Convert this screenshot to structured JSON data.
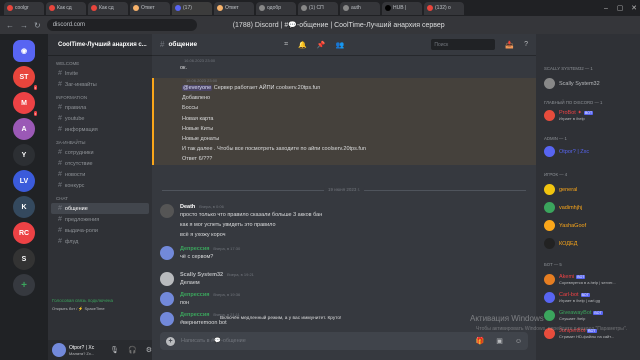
{
  "browser": {
    "tabs": [
      {
        "label": "coolgr",
        "color": "#e8453c"
      },
      {
        "label": "Как сд",
        "color": "#e8453c"
      },
      {
        "label": "Как сд",
        "color": "#e8453c"
      },
      {
        "label": "Ответ",
        "color": "#f6b26b"
      },
      {
        "label": "(17)",
        "color": "#5865f2"
      },
      {
        "label": "Ответ",
        "color": "#f6b26b"
      },
      {
        "label": "одобр",
        "color": "#888"
      },
      {
        "label": "(1) СП",
        "color": "#888"
      },
      {
        "label": "auth",
        "color": "#888"
      },
      {
        "label": "HUB |",
        "color": "#000"
      },
      {
        "label": "(132) о",
        "color": "#e8453c"
      }
    ],
    "url": "discord.com",
    "page_title": "(1788) Discord | #💬-общение | CoolTime-Лучший анархия сервер"
  },
  "left_bar": [
    "ST",
    "M",
    "A",
    "Y",
    "LV",
    "K",
    "RC",
    "S"
  ],
  "server_name": "CoolTime-Лучший анархия с...",
  "channels": {
    "top": [
      {
        "label": "Invite",
        "active": false
      },
      {
        "label": "Заг-инвайты",
        "active": false
      }
    ],
    "category1": "information",
    "info": [
      "правила",
      "youtube",
      "информация"
    ],
    "category2": "за-инвайты",
    "group": [
      "сотрудники",
      "отсутствие",
      "новости",
      "конкурс"
    ],
    "category3": "Chat",
    "chat": [
      {
        "label": "общение",
        "active": true
      },
      {
        "label": "предложения",
        "active": false
      },
      {
        "label": "выдача-роли",
        "active": false
      },
      {
        "label": "флуд",
        "active": false
      }
    ],
    "welcome_cat": "WELCOME"
  },
  "voice": {
    "status": "Голосовая связь подключена",
    "sub": "Открыть бот / ⚡ SpaceTime"
  },
  "user": {
    "name": "Otpor? | Xc",
    "tag": "Малата? Zx..."
  },
  "header": {
    "channel": "общение",
    "search_placeholder": "Поиск"
  },
  "messages": [
    {
      "author": "",
      "time": "16.06.2023 23:00",
      "author_color": "#e67e22",
      "lines": [
        "ок."
      ]
    },
    {
      "author": "",
      "time": "16.06.2023 23:00",
      "author_color": "#e67e22",
      "lines": [
        "@everyone Сервер работает АЙПИ coolserv.20tps.fun",
        "Добавлено",
        "Боссы",
        "Новая карта",
        "Новые Киты",
        "Новые донаты",
        "И так далее . Чтобы все посмотреть заходите по айпи coolserv.20tps.fun",
        "Ответ 6/???"
      ]
    },
    {
      "author": "Death",
      "time": "Вчера, в 0:06",
      "author_color": "#ffffff",
      "lines": [
        "просто только что правило сказали больше 3 акков бан",
        "как я мог успеть увидеть это правило",
        "всё я ухожу короч"
      ]
    },
    {
      "author": "Депрессия",
      "time": "Вчера, в 17:30",
      "author_color": "#3ba55d",
      "lines": [
        "чё с сервом?"
      ]
    },
    {
      "author": "Scally System32",
      "time": "Вчера, в 19:21",
      "author_color": "#b9bbbe",
      "lines": [
        "Делаем"
      ]
    },
    {
      "author": "Депрессия",
      "time": "Вчера, в 19:36",
      "author_color": "#3ba55d",
      "lines": [
        "пон"
      ]
    },
    {
      "author": "Депрессия",
      "time": "Вчера, в 21:11",
      "author_color": "#3ba55d",
      "lines": [
        "#вернитеmoon bot"
      ]
    }
  ],
  "date_divider": "19 июня 2023 г.",
  "composer_placeholder": "Написать в #💬-общение",
  "typing": "Включён медленный режим, а у вас иммунитет. Круто!",
  "members": {
    "cats": [
      {
        "label": "SCALLY SYSTEM32 — 1"
      },
      {
        "label": "ГЛАВНЫЙ ПО DISCORD — 1"
      },
      {
        "label": "ADMIN — 1"
      },
      {
        "label": "ИГРОК — 4"
      },
      {
        "label": "БОТ — 5"
      }
    ],
    "list": [
      {
        "name": "Scally System32",
        "color": "#b9bbbe",
        "status": "",
        "bot": false
      },
      {
        "name": "ProBot ✦",
        "color": "#ed4245",
        "status": "Играет в /help",
        "bot": true
      },
      {
        "name": "Otpor? | Zxc",
        "color": "#5865f2",
        "status": "",
        "bot": false
      },
      {
        "name": "general",
        "color": "#faa61a",
        "status": "",
        "bot": false
      },
      {
        "name": "vadimhjhj",
        "color": "#faa61a",
        "status": "",
        "bot": false
      },
      {
        "name": "YashaGoof",
        "color": "#faa61a",
        "status": "",
        "bot": false
      },
      {
        "name": "КОДЕД",
        "color": "#faa61a",
        "status": "",
        "bot": false
      },
      {
        "name": "Akemi",
        "color": "#ed4245",
        "status": "Соревнуется в a.help | server...",
        "bot": true
      },
      {
        "name": "Carl-bot",
        "color": "#ed4245",
        "status": "Играет в /help | carl.gg",
        "bot": true
      },
      {
        "name": "GiveawayBot",
        "color": "#3ba55d",
        "status": "Слушает /help",
        "bot": true
      },
      {
        "name": "JuniperBot",
        "color": "#ed4245",
        "status": "Стримит HD-файлы на сайт...",
        "bot": true
      }
    ]
  },
  "watermark": "Активация Windows",
  "watermark_sub": "Чтобы активировать Windows, перейдите в раздел \"Параметры\"."
}
